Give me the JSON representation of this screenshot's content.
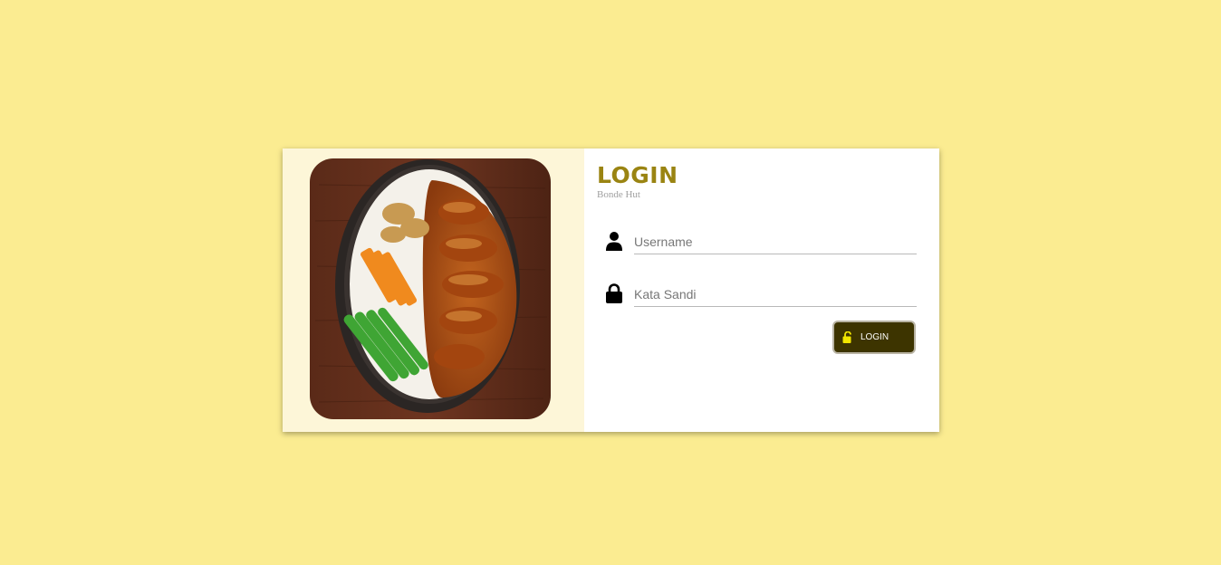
{
  "login": {
    "title": "LOGIN",
    "subtitle": "Bonde Hut",
    "username_placeholder": "Username",
    "password_placeholder": "Kata Sandi",
    "button_label": "LOGIN"
  },
  "icons": {
    "username": "user-icon",
    "password": "lock-icon",
    "button": "unlock-icon"
  },
  "colors": {
    "page_background": "#fbec91",
    "title": "#9a8412",
    "button_background": "#3d3400",
    "button_icon": "#f2e600"
  }
}
